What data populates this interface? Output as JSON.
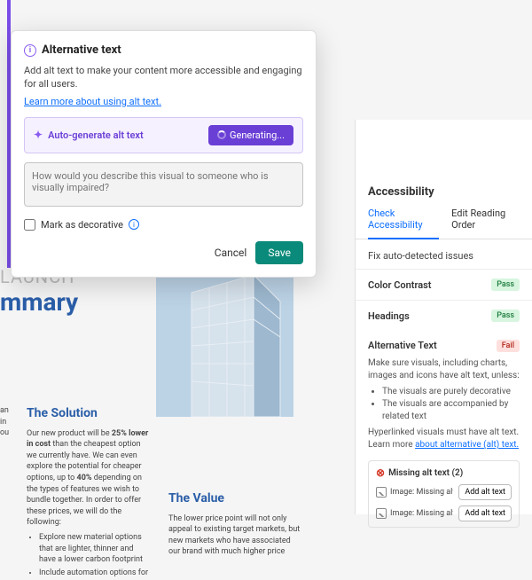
{
  "modal": {
    "title": "Alternative text",
    "description": "Add alt text to make your content more accessible and engaging for all users.",
    "learn_more": "Learn more about using alt text.",
    "autogen_label": "Auto-generate alt text",
    "generate_button": "Generating...",
    "textarea_placeholder": "How would you describe this visual to someone who is visually impaired?",
    "mark_decorative": "Mark as decorative",
    "cancel": "Cancel",
    "save": "Save"
  },
  "document": {
    "eyebrow": "LAUNCH",
    "title": "mmary",
    "col1_heading": "",
    "col1_body": "",
    "col2_heading": "The Solution",
    "col2_body": "Our new product will be <b>25% lower in cost</b> than the cheapest option we currently have. We can even explore the potential for cheaper options, up to <b>40%</b> depending on the types of features we wish to bundle together. In order to offer these prices, we will do the following:",
    "col2_bullets": [
      "Explore new material options that are lighter, thinner and have a lower carbon footprint",
      "Include automation options for"
    ],
    "col3_heading": "The Value",
    "col3_body": "The lower price point will not only appeal to existing target markets, but new markets who have associated our brand with much higher price"
  },
  "sidepanel": {
    "heading": "Accessibility",
    "tabs": [
      "Check Accessibility",
      "Edit Reading Order"
    ],
    "subhead": "Fix auto-detected issues",
    "rows": [
      {
        "label": "Color Contrast",
        "status": "Pass"
      },
      {
        "label": "Headings",
        "status": "Pass"
      }
    ],
    "alt_section": {
      "title": "Alternative Text",
      "status": "Fail",
      "body": "Make sure visuals, including charts, images and icons have alt text, unless:",
      "bullets": [
        "The visuals are purely decorative",
        "The visuals are accompanied by related text"
      ],
      "body2": "Hyperlinked visuals must have alt text.",
      "learn_prefix": "Learn more ",
      "learn_link": "about alternative (alt) text."
    },
    "missing": {
      "title": "Missing alt text (2)",
      "rows": [
        {
          "label": "Image: Missing alt text",
          "button": "Add alt text"
        },
        {
          "label": "Image: Missing alt text",
          "button": "Add alt text"
        }
      ]
    }
  }
}
